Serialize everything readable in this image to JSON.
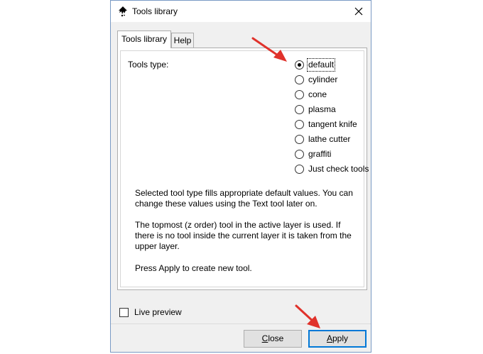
{
  "window": {
    "title": "Tools library",
    "close_glyph": "×"
  },
  "tabs": [
    {
      "label": "Tools library",
      "active": true
    },
    {
      "label": "Help",
      "active": false
    }
  ],
  "tools_type": {
    "label": "Tools type:",
    "options": [
      {
        "label": "default",
        "selected": true
      },
      {
        "label": "cylinder",
        "selected": false
      },
      {
        "label": "cone",
        "selected": false
      },
      {
        "label": "plasma",
        "selected": false
      },
      {
        "label": "tangent knife",
        "selected": false
      },
      {
        "label": "lathe cutter",
        "selected": false
      },
      {
        "label": "graffiti",
        "selected": false
      },
      {
        "label": "Just check tools",
        "selected": false
      }
    ]
  },
  "description": {
    "paragraph1": "Selected tool type fills appropriate default values. You can change these values using the Text tool later on.",
    "paragraph2": "The topmost (z order) tool in the active layer is used. If there is no tool inside the current layer it is taken from the upper layer.",
    "paragraph3": "Press Apply to create new tool."
  },
  "live_preview": {
    "label": "Live preview",
    "checked": false
  },
  "buttons": {
    "close_accel": "C",
    "close_rest": "lose",
    "apply_accel": "A",
    "apply_rest": "pply"
  },
  "annotation_color": "#e0322b",
  "icons": {
    "app": "inkscape-logo-icon",
    "close": "close-icon",
    "arrow": "red-pointer-arrow-icon"
  }
}
